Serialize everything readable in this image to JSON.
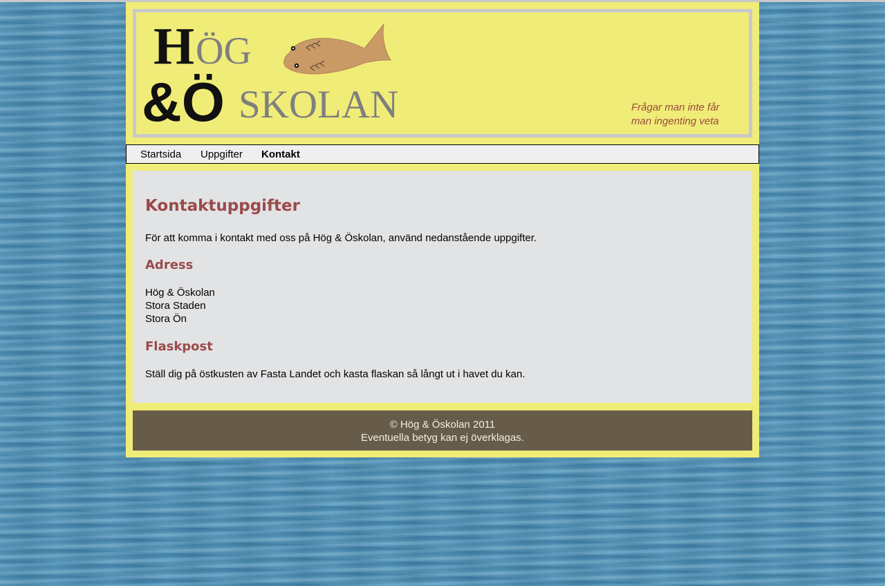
{
  "header": {
    "logo": {
      "line1_black": "H",
      "line1_gray": "ÖG",
      "line2_black": "&Ö",
      "line2_gray": "SKOLAN"
    },
    "tagline_line1": "Frågar man inte får",
    "tagline_line2": "man ingenting veta"
  },
  "nav": {
    "items": [
      {
        "label": "Startsida",
        "active": false
      },
      {
        "label": "Uppgifter",
        "active": false
      },
      {
        "label": "Kontakt",
        "active": true
      }
    ]
  },
  "content": {
    "title": "Kontaktuppgifter",
    "intro": "För att komma i kontakt med oss på Hög & Öskolan, använd nedanstående uppgifter.",
    "address_heading": "Adress",
    "address_lines": [
      "Hög & Öskolan",
      "Stora Staden",
      "Stora Ön"
    ],
    "bottlepost_heading": "Flaskpost",
    "bottlepost_text": "Ställ dig på östkusten av Fasta Landet och kasta flaskan så långt ut i havet du kan."
  },
  "footer": {
    "line1": "© Hög & Öskolan 2011",
    "line2": "Eventuella betyg kan ej överklagas."
  },
  "colors": {
    "page_bg": "#f0ec78",
    "header_border": "#c9c9c9",
    "heading": "#9a4a4a",
    "tagline": "#9a4a3a",
    "content_bg": "#e2e3e5",
    "footer_bg": "#675c49",
    "fish": "#c99a66"
  }
}
